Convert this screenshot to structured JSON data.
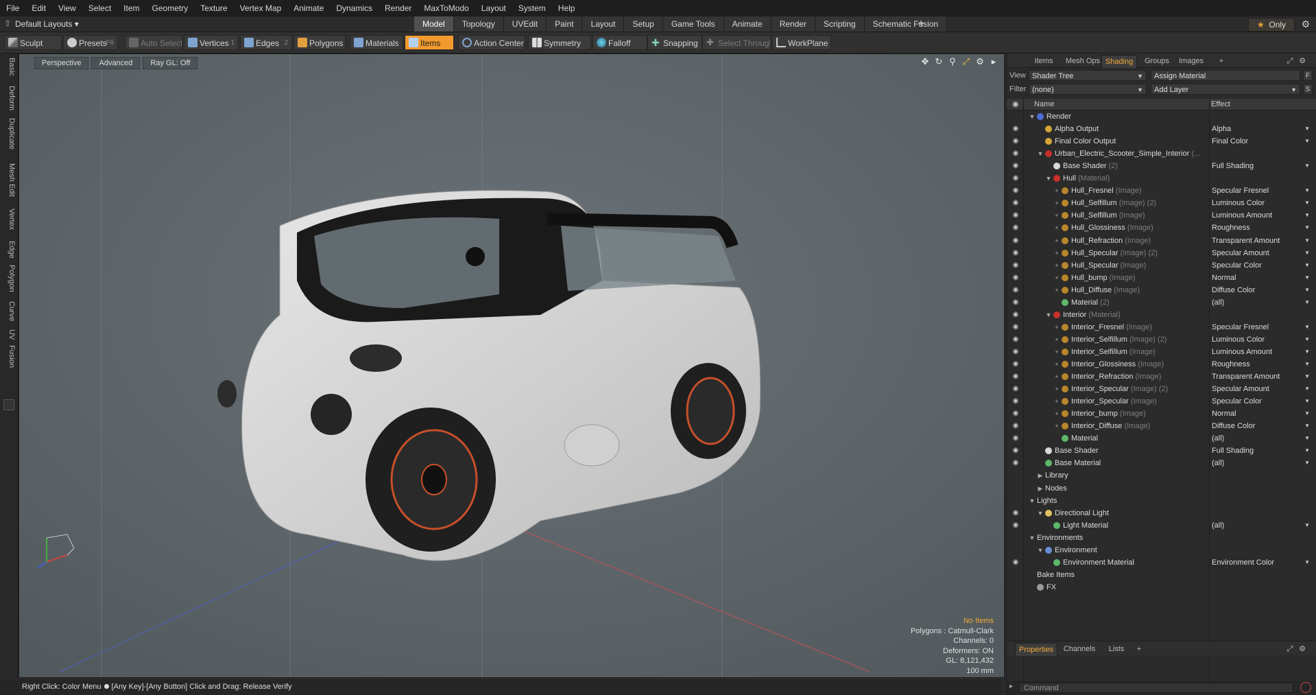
{
  "menu": [
    "File",
    "Edit",
    "View",
    "Select",
    "Item",
    "Geometry",
    "Texture",
    "Vertex Map",
    "Animate",
    "Dynamics",
    "Render",
    "MaxToModo",
    "Layout",
    "System",
    "Help"
  ],
  "layout": {
    "selector": "Default Layouts ▾",
    "tabs": [
      "Model",
      "Topology",
      "UVEdit",
      "Paint",
      "Layout",
      "Setup",
      "Game Tools",
      "Animate",
      "Render",
      "Scripting",
      "Schematic Fusion"
    ],
    "active_tab": "Model",
    "plus": "+",
    "only": "Only"
  },
  "toolbar": {
    "sculpt": "Sculpt",
    "presets": "Presets",
    "presets_key": "F6",
    "auto_select": "Auto Select",
    "vertices": "Vertices",
    "vertices_key": "1",
    "edges": "Edges",
    "edges_key": "2",
    "polygons": "Polygons",
    "materials": "Materials",
    "items": "Items",
    "action_center": "Action Center",
    "symmetry": "Symmetry",
    "falloff": "Falloff",
    "snapping": "Snapping",
    "select_through": "Select Through",
    "workplane": "WorkPlane"
  },
  "left_tabs": [
    "Basic",
    "Deform",
    "Duplicate",
    "Mesh Edit",
    "Vertex",
    "Edge",
    "Polygon",
    "Curve",
    "UV",
    "Fusion"
  ],
  "viewport": {
    "view": "Perspective",
    "style": "Advanced",
    "raygl": "Ray GL: Off",
    "info": {
      "no_items": "No Items",
      "polygons": "Polygons : Catmull-Clark",
      "channels": "Channels: 0",
      "deformers": "Deformers: ON",
      "gl": "GL: 8,121,432",
      "scale": "100 mm"
    }
  },
  "status": {
    "left": "Right Click: Color Menu",
    "right": "[Any Key]-[Any Button] Click and Drag: Release Verify"
  },
  "panel": {
    "tabs": [
      "Items",
      "Mesh Ops",
      "Shading",
      "Groups",
      "Images"
    ],
    "active_tab": "Shading",
    "view_label": "View",
    "view_value": "Shader Tree",
    "assign": "Assign Material",
    "f_btn": "F",
    "filter_label": "Filter",
    "filter_value": "(none)",
    "add_layer": "Add Layer",
    "s_btn": "S",
    "col_name": "Name",
    "col_effect": "Effect"
  },
  "tree": [
    {
      "d": 0,
      "tw": "▼",
      "icon": "#4b6fd6",
      "name": "Render",
      "sub": "",
      "effect": "",
      "eye": false
    },
    {
      "d": 1,
      "tw": "",
      "icon": "#d6a53a",
      "name": "Alpha Output",
      "sub": "",
      "effect": "Alpha",
      "eye": true
    },
    {
      "d": 1,
      "tw": "",
      "icon": "#d6a53a",
      "name": "Final Color Output",
      "sub": "",
      "effect": "Final Color",
      "eye": true
    },
    {
      "d": 1,
      "tw": "▼",
      "icon": "#c9302c",
      "name": "Urban_Electric_Scooter_Simple_Interior",
      "sub": " (...",
      "effect": "",
      "eye": true
    },
    {
      "d": 2,
      "tw": "",
      "icon": "#d8d8d8",
      "name": "Base Shader",
      "sub": " (2)",
      "effect": "Full Shading",
      "eye": true
    },
    {
      "d": 2,
      "tw": "▼",
      "icon": "#c9302c",
      "name": "Hull",
      "sub": " (Material)",
      "effect": "",
      "eye": true
    },
    {
      "d": 3,
      "tw": "+",
      "icon": "#b8862b",
      "name": "Hull_Fresnel",
      "sub": " (Image)",
      "effect": "Specular Fresnel",
      "eye": true
    },
    {
      "d": 3,
      "tw": "+",
      "icon": "#b8862b",
      "name": "Hull_Selfillum",
      "sub": " (Image) (2)",
      "effect": "Luminous Color",
      "eye": true
    },
    {
      "d": 3,
      "tw": "+",
      "icon": "#b8862b",
      "name": "Hull_Selfillum",
      "sub": " (Image)",
      "effect": "Luminous Amount",
      "eye": true
    },
    {
      "d": 3,
      "tw": "+",
      "icon": "#b8862b",
      "name": "Hull_Glossiness",
      "sub": " (Image)",
      "effect": "Roughness",
      "eye": true
    },
    {
      "d": 3,
      "tw": "+",
      "icon": "#b8862b",
      "name": "Hull_Refraction",
      "sub": " (Image)",
      "effect": "Transparent Amount",
      "eye": true
    },
    {
      "d": 3,
      "tw": "+",
      "icon": "#b8862b",
      "name": "Hull_Specular",
      "sub": " (Image) (2)",
      "effect": "Specular Amount",
      "eye": true
    },
    {
      "d": 3,
      "tw": "+",
      "icon": "#b8862b",
      "name": "Hull_Specular",
      "sub": " (Image)",
      "effect": "Specular Color",
      "eye": true
    },
    {
      "d": 3,
      "tw": "+",
      "icon": "#b8862b",
      "name": "Hull_bump",
      "sub": " (Image)",
      "effect": "Normal",
      "eye": true
    },
    {
      "d": 3,
      "tw": "+",
      "icon": "#b8862b",
      "name": "Hull_Diffuse",
      "sub": " (Image)",
      "effect": "Diffuse Color",
      "eye": true
    },
    {
      "d": 3,
      "tw": "",
      "icon": "#5db86a",
      "name": "Material",
      "sub": " (2)",
      "effect": "(all)",
      "eye": true
    },
    {
      "d": 2,
      "tw": "▼",
      "icon": "#c9302c",
      "name": "Interior",
      "sub": " (Material)",
      "effect": "",
      "eye": true
    },
    {
      "d": 3,
      "tw": "+",
      "icon": "#b8862b",
      "name": "Interior_Fresnel",
      "sub": " (Image)",
      "effect": "Specular Fresnel",
      "eye": true
    },
    {
      "d": 3,
      "tw": "+",
      "icon": "#b8862b",
      "name": "Interior_Selfillum",
      "sub": " (Image) (2)",
      "effect": "Luminous Color",
      "eye": true
    },
    {
      "d": 3,
      "tw": "+",
      "icon": "#b8862b",
      "name": "Interior_Selfillum",
      "sub": " (Image)",
      "effect": "Luminous Amount",
      "eye": true
    },
    {
      "d": 3,
      "tw": "+",
      "icon": "#b8862b",
      "name": "Interior_Glossiness",
      "sub": " (Image)",
      "effect": "Roughness",
      "eye": true
    },
    {
      "d": 3,
      "tw": "+",
      "icon": "#b8862b",
      "name": "Interior_Refraction",
      "sub": " (Image)",
      "effect": "Transparent Amount",
      "eye": true
    },
    {
      "d": 3,
      "tw": "+",
      "icon": "#b8862b",
      "name": "Interior_Specular",
      "sub": " (Image) (2)",
      "effect": "Specular Amount",
      "eye": true
    },
    {
      "d": 3,
      "tw": "+",
      "icon": "#b8862b",
      "name": "Interior_Specular",
      "sub": " (Image)",
      "effect": "Specular Color",
      "eye": true
    },
    {
      "d": 3,
      "tw": "+",
      "icon": "#b8862b",
      "name": "Interior_bump",
      "sub": " (Image)",
      "effect": "Normal",
      "eye": true
    },
    {
      "d": 3,
      "tw": "+",
      "icon": "#b8862b",
      "name": "Interior_Diffuse",
      "sub": " (Image)",
      "effect": "Diffuse Color",
      "eye": true
    },
    {
      "d": 3,
      "tw": "",
      "icon": "#5db86a",
      "name": "Material",
      "sub": "",
      "effect": "(all)",
      "eye": true
    },
    {
      "d": 1,
      "tw": "",
      "icon": "#d8d8d8",
      "name": "Base Shader",
      "sub": "",
      "effect": "Full Shading",
      "eye": true
    },
    {
      "d": 1,
      "tw": "",
      "icon": "#5db86a",
      "name": "Base Material",
      "sub": "",
      "effect": "(all)",
      "eye": true
    },
    {
      "d": 1,
      "tw": "▶",
      "icon": "",
      "name": "Library",
      "sub": "",
      "effect": "",
      "eye": false
    },
    {
      "d": 1,
      "tw": "▶",
      "icon": "",
      "name": "Nodes",
      "sub": "",
      "effect": "",
      "eye": false
    },
    {
      "d": 0,
      "tw": "▼",
      "icon": "",
      "name": "Lights",
      "sub": "",
      "effect": "",
      "eye": false
    },
    {
      "d": 1,
      "tw": "▼",
      "icon": "#e0c060",
      "name": "Directional Light",
      "sub": "",
      "effect": "",
      "eye": true
    },
    {
      "d": 2,
      "tw": "",
      "icon": "#5db86a",
      "name": "Light Material",
      "sub": "",
      "effect": "(all)",
      "eye": true
    },
    {
      "d": 0,
      "tw": "▼",
      "icon": "",
      "name": "Environments",
      "sub": "",
      "effect": "",
      "eye": false
    },
    {
      "d": 1,
      "tw": "▼",
      "icon": "#6a8fd6",
      "name": "Environment",
      "sub": "",
      "effect": "",
      "eye": false
    },
    {
      "d": 2,
      "tw": "",
      "icon": "#5db86a",
      "name": "Environment Material",
      "sub": "",
      "effect": "Environment Color",
      "eye": true
    },
    {
      "d": 0,
      "tw": "",
      "icon": "",
      "name": "Bake Items",
      "sub": "",
      "effect": "",
      "eye": false
    },
    {
      "d": 0,
      "tw": "",
      "icon": "#9a9a9a",
      "name": "FX",
      "sub": "",
      "effect": "",
      "eye": false
    }
  ],
  "bottom": {
    "tabs": [
      "Properties",
      "Channels",
      "Lists"
    ],
    "active_tab": "Properties",
    "command_placeholder": "Command"
  }
}
